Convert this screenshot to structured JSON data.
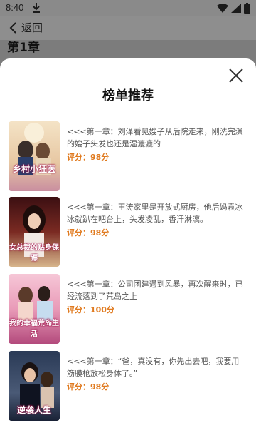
{
  "status_bar": {
    "time": "8:40"
  },
  "nav": {
    "back_label": "返回"
  },
  "chapter": {
    "title": "第1章"
  },
  "sheet": {
    "title": "榜单推荐",
    "books": [
      {
        "cover_title": "乡村小狂医",
        "description": "<<<第一章：刘泽看见嫂子从后院走来，刚洗完澡的嫂子头发也还是湿漉漉的",
        "score": "评分：98分"
      },
      {
        "cover_title": "女总裁的贴身保镖",
        "description": "<<<第一章：王涛家里是开放式厨房，他后妈袁冰冰就趴在吧台上，头发凌乱，香汗淋漓。",
        "score": "评分：98分"
      },
      {
        "cover_title": "我的幸福荒岛生活",
        "description": "<<<第一章：公司团建遇到风暴，再次醒来时，已经流落到了荒岛之上",
        "score": "评分：100分"
      },
      {
        "cover_title": "逆袭人生",
        "description": "<<<第一章：“爸，真没有，你先出去吧，我要用筋膜枪放松身体了。”",
        "score": "评分：98分"
      }
    ]
  }
}
